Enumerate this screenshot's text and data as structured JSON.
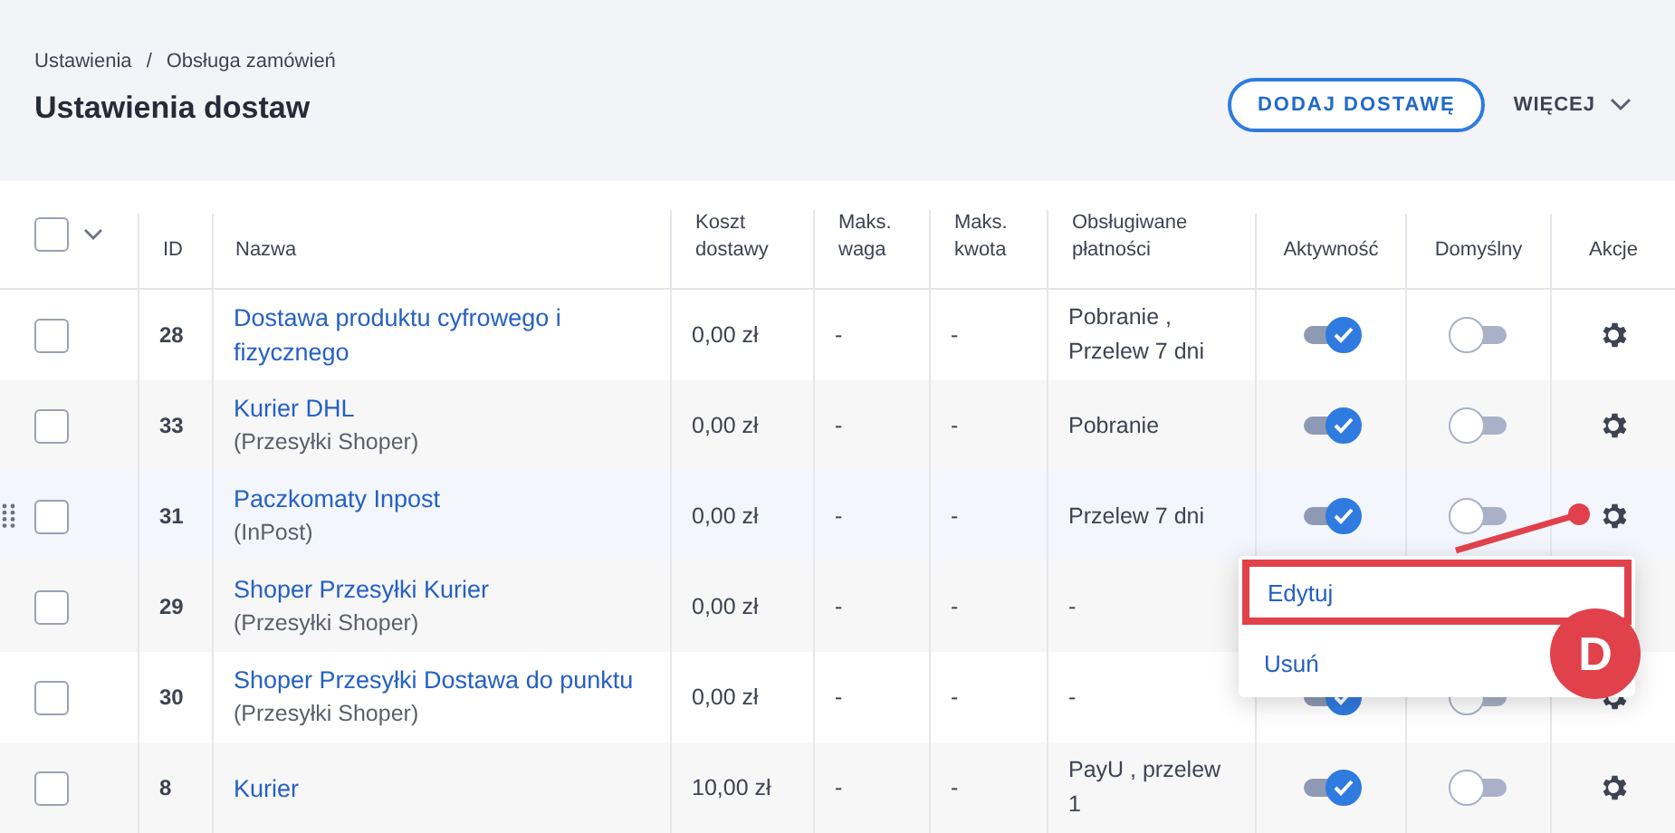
{
  "breadcrumb": {
    "items": [
      "Ustawienia",
      "Obsługa zamówień"
    ],
    "separator": "/"
  },
  "title": "Ustawienia dostaw",
  "primary_button": "DODAJ DOSTAWĘ",
  "more_button": "WIĘCEJ",
  "table": {
    "select_all": {
      "checked": false
    },
    "columns": [
      "ID",
      "Nazwa",
      "Koszt\ndostawy",
      "Maks.\nwaga",
      "Maks.\nkwota",
      "Obsługiwane\npłatności",
      "Aktywność",
      "Domyślny",
      "Akcje"
    ],
    "rows": [
      {
        "checked": false,
        "hovered": false,
        "id": "28",
        "name": "Dostawa produktu cyfrowego i fizycznego",
        "provider": "",
        "cost": "0,00 zł",
        "max_weight": "-",
        "max_amount": "-",
        "payments": "Pobranie ,\nPrzelew 7 dni",
        "active": true,
        "default": false
      },
      {
        "checked": false,
        "hovered": false,
        "id": "33",
        "name": "Kurier DHL",
        "provider": "(Przesyłki Shoper)",
        "cost": "0,00 zł",
        "max_weight": "-",
        "max_amount": "-",
        "payments": "Pobranie",
        "active": true,
        "default": false
      },
      {
        "checked": false,
        "hovered": true,
        "id": "31",
        "name": "Paczkomaty Inpost",
        "provider": "(InPost)",
        "cost": "0,00 zł",
        "max_weight": "-",
        "max_amount": "-",
        "payments": "Przelew 7 dni",
        "active": true,
        "default": false
      },
      {
        "checked": false,
        "hovered": false,
        "id": "29",
        "name": "Shoper Przesyłki Kurier",
        "provider": "(Przesyłki Shoper)",
        "cost": "0,00 zł",
        "max_weight": "-",
        "max_amount": "-",
        "payments": "-"
      },
      {
        "checked": false,
        "hovered": false,
        "id": "30",
        "name": "Shoper Przesyłki Dostawa do punktu",
        "provider": "(Przesyłki Shoper)",
        "cost": "0,00 zł",
        "max_weight": "-",
        "max_amount": "-",
        "payments": "-",
        "active": true,
        "default": false
      },
      {
        "checked": false,
        "hovered": false,
        "id": "8",
        "name": "Kurier",
        "provider": "",
        "cost": "10,00 zł",
        "max_weight": "-",
        "max_amount": "-",
        "payments": "PayU , przelew\n1",
        "active": true,
        "default": false
      }
    ]
  },
  "context_menu": {
    "items": [
      {
        "label": "Edytuj",
        "marked": true
      },
      {
        "label": "Usuń",
        "marked": false
      }
    ]
  },
  "annotation": {
    "label": "D"
  }
}
